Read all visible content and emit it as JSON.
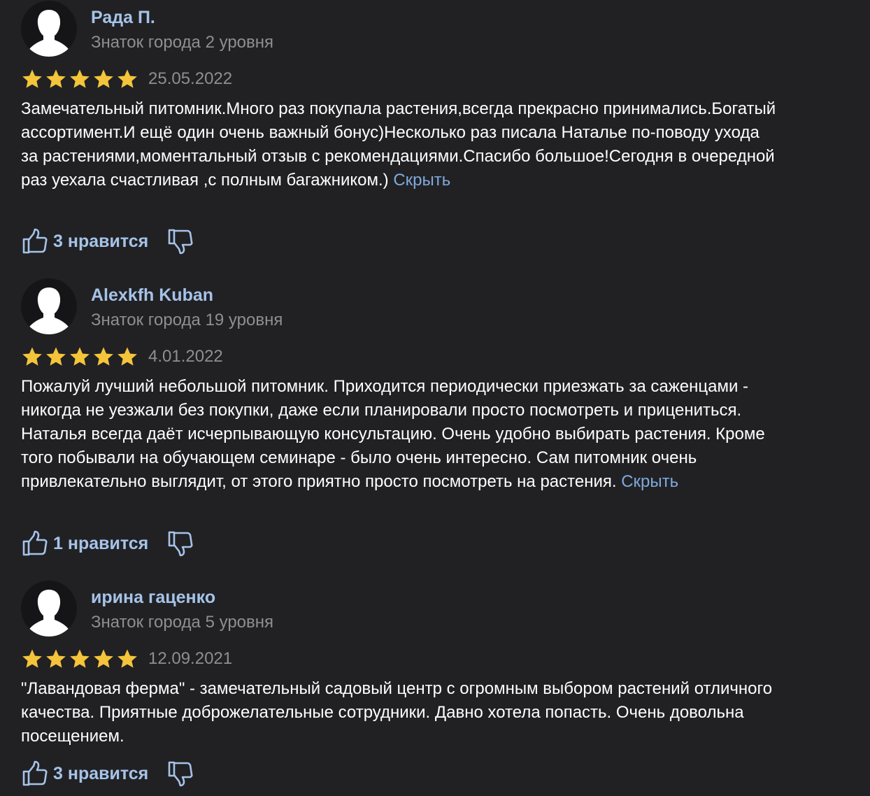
{
  "colors": {
    "background": "#212124",
    "author_name": "#a6c3e8",
    "muted_text": "#8e8e93",
    "link": "#7fa9dc",
    "star": "#f4c43a",
    "icon_stroke": "#a6c3e8"
  },
  "reviews": [
    {
      "author": "Рада П.",
      "level": "Знаток города 2 уровня",
      "rating": 5,
      "date": "25.05.2022",
      "text": "Замечательный питомник.Много раз покупала растения,всегда прекрасно принимались.Богатый ассортимент.И ещё один очень важный бонус)Несколько раз писала Наталье по-поводу ухода за растениями,моментальный отзыв с рекомендациями.Спасибо большое!Сегодня в очередной раз уехала счастливая ,с полным багажником.)",
      "collapse_label": "Скрыть",
      "likes": "3 нравится",
      "avatar_icon": "user-silhouette-icon",
      "like_icon": "thumbs-up-icon",
      "dislike_icon": "thumbs-down-icon"
    },
    {
      "author": "Alexkfh Kuban",
      "level": "Знаток города 19 уровня",
      "rating": 5,
      "date": "4.01.2022",
      "text": "Пожалуй лучший небольшой питомник. Приходится периодически приезжать за саженцами - никогда не уезжали без покупки, даже если планировали просто посмотреть и прицениться. Наталья всегда даёт исчерпывающую консультацию. Очень удобно выбирать растения. Кроме того побывали на обучающем семинаре - было очень интересно. Сам питомник очень привлекательно выглядит, от этого приятно просто посмотреть на растения.",
      "collapse_label": "Скрыть",
      "likes": "1 нравится",
      "avatar_icon": "user-silhouette-icon",
      "like_icon": "thumbs-up-icon",
      "dislike_icon": "thumbs-down-icon"
    },
    {
      "author": "ирина гаценко",
      "level": "Знаток города 5 уровня",
      "rating": 5,
      "date": "12.09.2021",
      "text": "\"Лавандовая ферма\" - замечательный садовый центр с огромным выбором растений отличного качества. Приятные доброжелательные сотрудники. Давно хотела попасть. Очень довольна посещением.",
      "collapse_label": "",
      "likes": "3 нравится",
      "avatar_icon": "user-silhouette-icon",
      "like_icon": "thumbs-up-icon",
      "dislike_icon": "thumbs-down-icon"
    }
  ]
}
